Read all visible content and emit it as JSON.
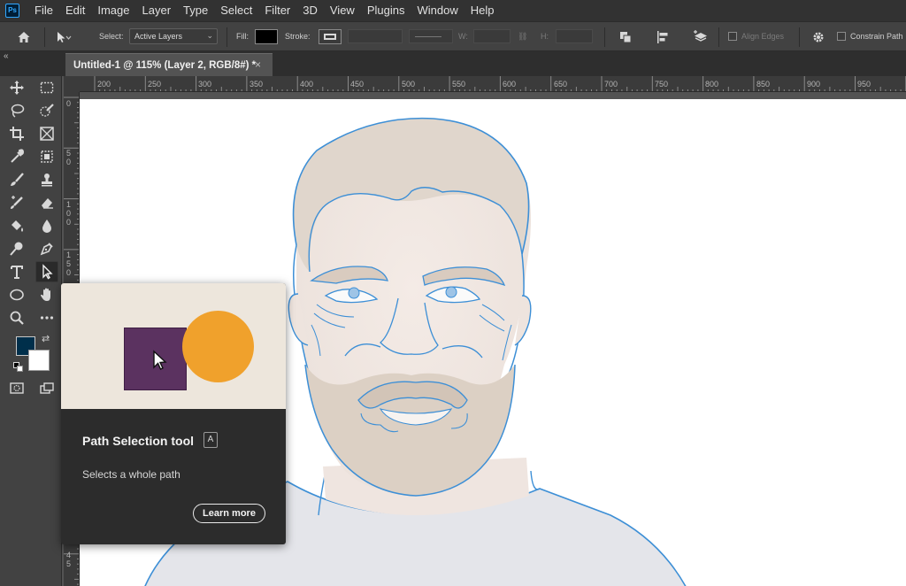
{
  "app": {
    "logo_text": "Ps",
    "menu": [
      "File",
      "Edit",
      "Image",
      "Layer",
      "Type",
      "Select",
      "Filter",
      "3D",
      "View",
      "Plugins",
      "Window",
      "Help"
    ]
  },
  "options_bar": {
    "select_label": "Select:",
    "select_value": "Active Layers",
    "fill_label": "Fill:",
    "fill_color": "#000000",
    "stroke_label": "Stroke:",
    "w_label": "W:",
    "h_label": "H:",
    "align_edges_label": "Align Edges",
    "constrain_path_label": "Constrain Path"
  },
  "document": {
    "tab_title": "Untitled-1 @ 115% (Layer 2, RGB/8#) *",
    "close_glyph": "×",
    "collapse_glyph": "«"
  },
  "rulers": {
    "top": [
      "200",
      "250",
      "300",
      "350",
      "400",
      "450",
      "500",
      "550",
      "600",
      "650",
      "700",
      "750",
      "800",
      "850",
      "900",
      "950"
    ],
    "left": [
      "0",
      "5 0",
      "1 0 0",
      "1 5 0",
      "4 5"
    ]
  },
  "toolbar": {
    "foreground_color": "#002f4b",
    "background_color": "#ffffff",
    "selected_tool": "path-selection-tool"
  },
  "tooltip": {
    "title": "Path Selection tool",
    "shortcut": "A",
    "description": "Selects a whole path",
    "learn_more": "Learn more",
    "preview_bg": "#ede6dc",
    "square_color": "#5b3260",
    "circle_color": "#f0a12c"
  }
}
